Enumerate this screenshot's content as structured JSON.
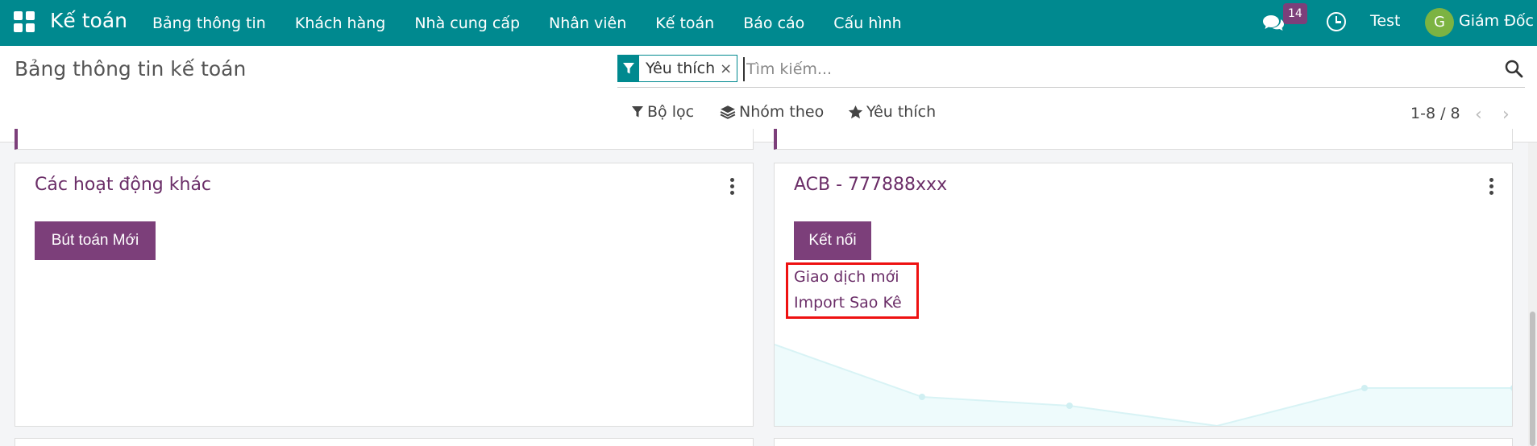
{
  "navbar": {
    "brand": "Kế toán",
    "menu": [
      "Bảng thông tin",
      "Khách hàng",
      "Nhà cung cấp",
      "Nhân viên",
      "Kế toán",
      "Báo cáo",
      "Cấu hình"
    ],
    "chat_badge": "14",
    "company_label": "Test",
    "avatar_letter": "G",
    "user_name": "Giám Đốc"
  },
  "control": {
    "title": "Bảng thông tin kế toán",
    "facet_label": "Yêu thích",
    "facet_close": "×",
    "search_placeholder": "Tìm kiếm...",
    "filter_label": "Bộ lọc",
    "group_label": "Nhóm theo",
    "favorites_label": "Yêu thích",
    "pager": "1-8 / 8",
    "pager_prev": "‹",
    "pager_next": "›"
  },
  "cards": {
    "misc": {
      "title": "Các hoạt động khác",
      "button": "Bút toán Mới"
    },
    "bank": {
      "title": "ACB - 777888xxx",
      "button": "Kết nối",
      "link_new": "Giao dịch mới",
      "link_import": "Import Sao Kê"
    }
  },
  "colors": {
    "navbar": "#00898f",
    "primary": "#7c3f7a",
    "highlight": "#e11111"
  }
}
